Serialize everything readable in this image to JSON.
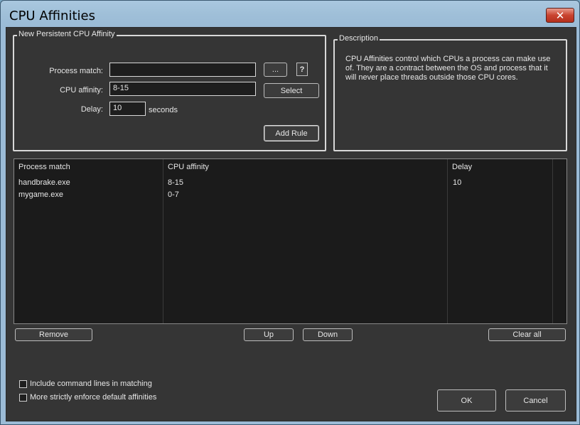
{
  "window": {
    "title": "CPU Affinities",
    "close_symbol": "✕"
  },
  "new_rule": {
    "legend": "New Persistent CPU Affinity",
    "process_label": "Process match:",
    "process_value": "",
    "browse_label": "...",
    "help_label": "?",
    "affinity_label": "CPU affinity:",
    "affinity_value": "8-15",
    "select_label": "Select",
    "delay_label": "Delay:",
    "delay_value": "10",
    "delay_unit": "seconds",
    "add_label": "Add Rule"
  },
  "description": {
    "legend": "Description",
    "text": "CPU Affinities control which CPUs a process can make use of. They are a contract between the OS and process that it will never place threads outside those CPU cores."
  },
  "table": {
    "headers": [
      "Process match",
      "CPU affinity",
      "Delay"
    ],
    "rows": [
      [
        "handbrake.exe",
        "8-15",
        "10"
      ],
      [
        "mygame.exe",
        "0-7",
        ""
      ]
    ]
  },
  "actions": {
    "remove": "Remove",
    "up": "Up",
    "down": "Down",
    "clear": "Clear all"
  },
  "options": {
    "include_cmd": "Include command lines in matching",
    "strict": "More strictly enforce default affinities"
  },
  "footer": {
    "ok": "OK",
    "cancel": "Cancel"
  }
}
